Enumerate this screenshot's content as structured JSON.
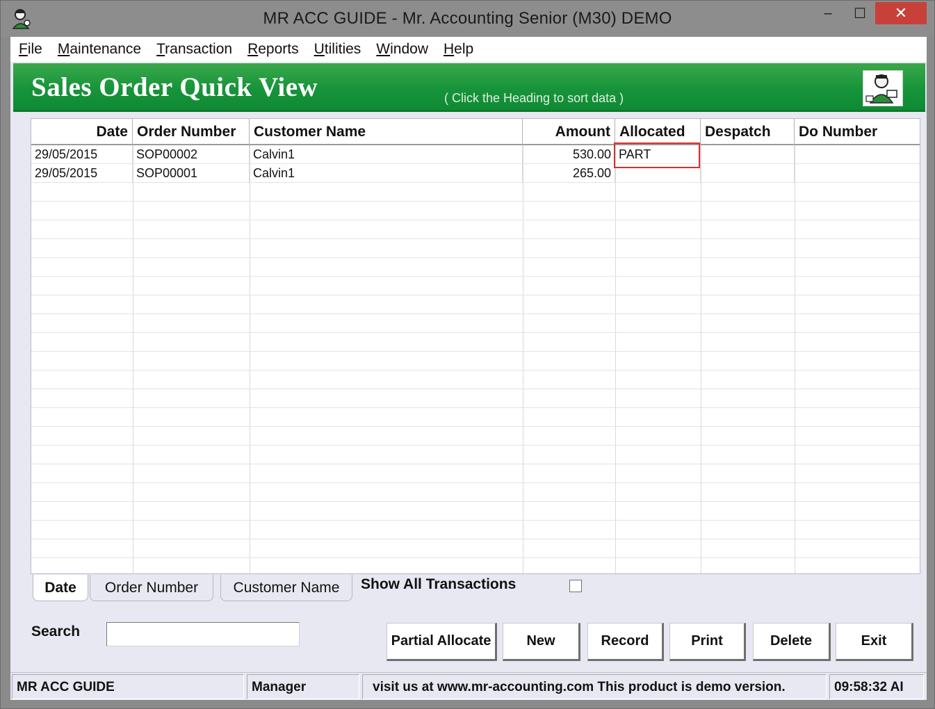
{
  "window": {
    "title": "MR ACC GUIDE - Mr. Accounting Senior (M30) DEMO",
    "minimize_glyph": "‒",
    "maximize_glyph": "☐",
    "close_glyph": "✕"
  },
  "menu": [
    {
      "key": "F",
      "rest": "ile"
    },
    {
      "key": "M",
      "rest": "aintenance"
    },
    {
      "key": "T",
      "rest": "ransaction"
    },
    {
      "key": "R",
      "rest": "eports"
    },
    {
      "key": "U",
      "rest": "tilities"
    },
    {
      "key": "W",
      "rest": "indow"
    },
    {
      "key": "H",
      "rest": "elp"
    }
  ],
  "banner": {
    "title": "Sales Order Quick View",
    "hint": "( Click the Heading to sort data )",
    "accent_color": "#17943a"
  },
  "grid": {
    "columns": [
      "Date",
      "Order Number",
      "Customer Name",
      "Amount",
      "Allocated",
      "Despatch",
      "Do Number"
    ],
    "rows": [
      {
        "date": "29/05/2015",
        "order_number": "SOP00002",
        "customer_name": "Calvin1",
        "amount": "530.00",
        "allocated": "PART",
        "despatch": "",
        "do_number": ""
      },
      {
        "date": "29/05/2015",
        "order_number": "SOP00001",
        "customer_name": "Calvin1",
        "amount": "265.00",
        "allocated": "",
        "despatch": "",
        "do_number": ""
      }
    ],
    "highlight_color": "#d9302c"
  },
  "tabs": {
    "date": "Date",
    "order_number": "Order Number",
    "customer_name": "Customer Name"
  },
  "show_all": {
    "label": "Show All Transactions",
    "checked": false
  },
  "search": {
    "label": "Search",
    "value": ""
  },
  "buttons": {
    "partial_allocate": "Partial Allocate",
    "new": "New",
    "record": "Record",
    "print": "Print",
    "delete": "Delete",
    "exit": "Exit"
  },
  "status": {
    "app": "MR ACC GUIDE",
    "user": "Manager",
    "message": "visit us at www.mr-accounting.com This product is demo version.",
    "time": "09:58:32 AI"
  }
}
